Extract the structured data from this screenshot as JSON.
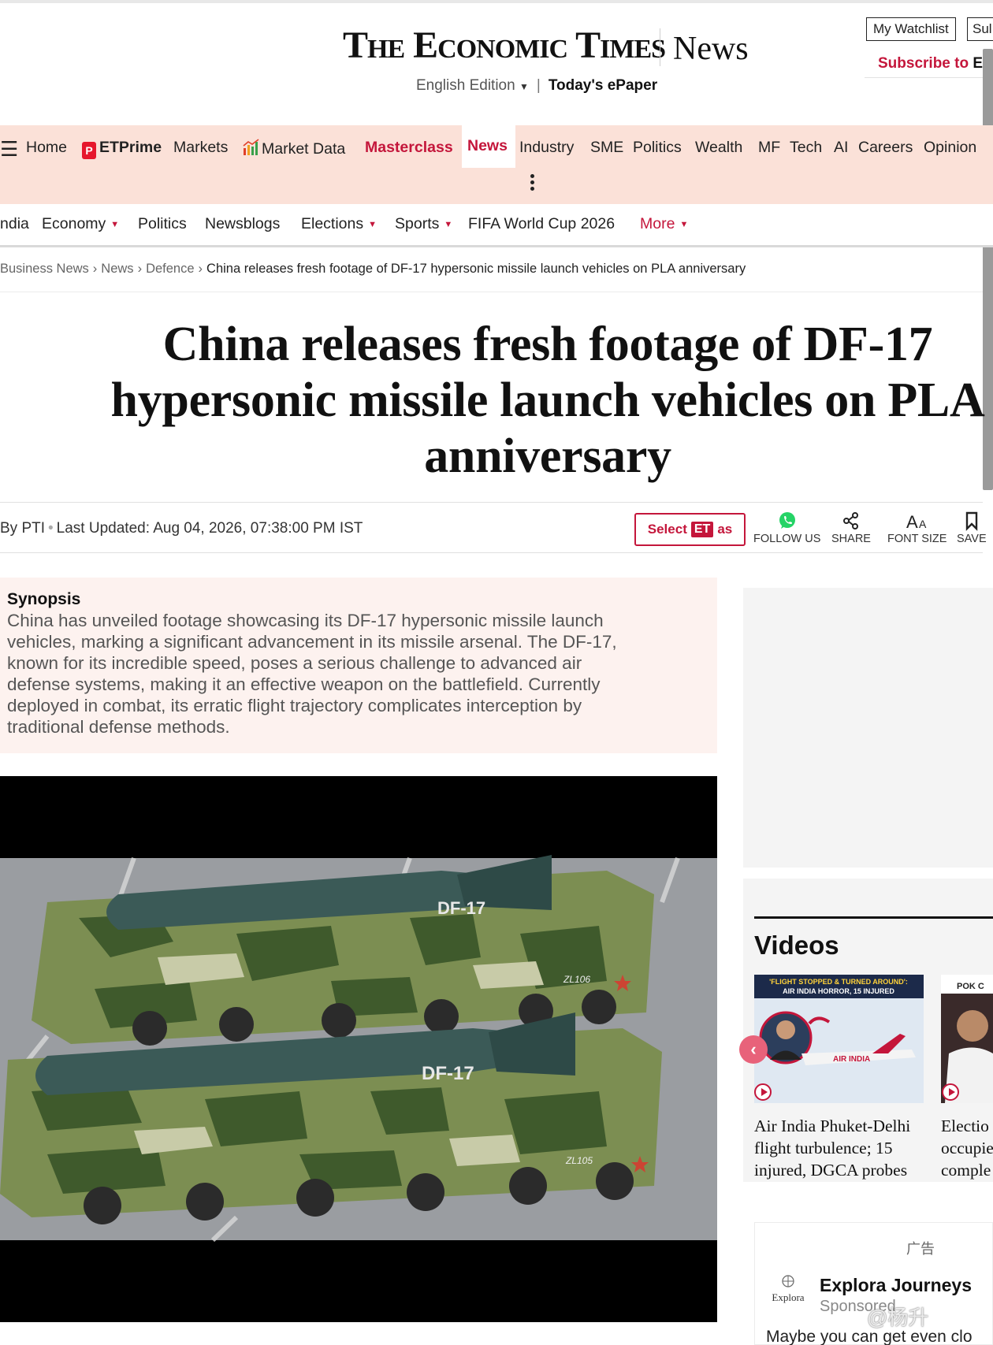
{
  "masthead": {
    "logo": "The Economic Times",
    "section": "News",
    "edition": "English Edition",
    "epaper": "Today's ePaper",
    "watchlist": "My Watchlist",
    "subscribe_short": "Sul",
    "subscribe_red": "Subscribe to",
    "subscribe_dark": "ET"
  },
  "main_nav": {
    "items": [
      "Home",
      "ETPrime",
      "Markets",
      "Market Data",
      "Masterclass",
      "News",
      "Industry",
      "SME",
      "Politics",
      "Wealth",
      "MF",
      "Tech",
      "AI",
      "Careers",
      "Opinion"
    ]
  },
  "sub_nav": {
    "items": [
      "ndia",
      "Economy",
      "Politics",
      "Newsblogs",
      "Elections",
      "Sports",
      "FIFA World Cup 2026",
      "More"
    ]
  },
  "breadcrumb": [
    "Business News",
    "News",
    "Defence",
    "China releases fresh footage of DF-17 hypersonic missile launch vehicles on PLA anniversary"
  ],
  "article": {
    "headline_lines": [
      "China releases fresh footage of DF-17",
      "hypersonic missile launch vehicles on PLA",
      "anniversary"
    ],
    "byline": "By PTI",
    "updated": "Last Updated: Aug 04, 2026, 07:38:00 PM IST",
    "select_label": "Select",
    "select_et": "ET",
    "select_as": "as",
    "tools": [
      "FOLLOW US",
      "SHARE",
      "FONT SIZE",
      "SAVE"
    ],
    "synopsis_label": "Synopsis",
    "synopsis_lines": [
      "China has unveiled footage showcasing its DF-17 hypersonic missile launch",
      "vehicles, marking a significant advancement in its missile arsenal. The DF-17,",
      "known for its incredible speed, poses a serious challenge to advanced air",
      "defense systems, making it an effective weapon on the battlefield. Currently",
      "deployed in combat, its erratic flight trajectory complicates interception by",
      "traditional defense methods."
    ],
    "image_labels": [
      "DF-17",
      "DF-17",
      "ZL106",
      "ZL105"
    ]
  },
  "videos": {
    "title": "Videos",
    "thumb1_banner_a": "'FLIGHT STOPPED & TURNED AROUND':",
    "thumb1_banner_b": "AIR INDIA HORROR, 15 INJURED",
    "thumb1_plane": "AIR INDIA",
    "thumb2_banner": "POK C",
    "item1_lines": [
      "Air India Phuket-Delhi",
      "flight turbulence; 15",
      "injured, DGCA probes"
    ],
    "item2_lines": [
      "Electio",
      "occupie",
      "comple"
    ]
  },
  "sponsored": {
    "ad_label": "广告",
    "logo_text": "Explora",
    "name": "Explora Journeys",
    "sponsored": "Sponsored",
    "body": "Maybe you can get even clo"
  },
  "watermark": "@杨升",
  "colors": {
    "brand_red": "#c4163b",
    "nav_bg": "#fbe1d8",
    "synopsis_bg": "#fdf2ef"
  }
}
